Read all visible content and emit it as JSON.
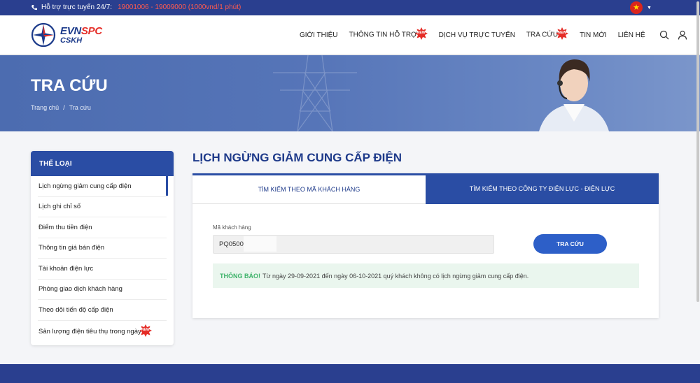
{
  "topbar": {
    "hotline_label": "Hỗ trợ trực tuyến 24/7:",
    "hotline_numbers": "19001006 - 19009000 (1000vnd/1 phút)",
    "language": "vi"
  },
  "header": {
    "logo_line1_a": "EVN",
    "logo_line1_b": "SPC",
    "logo_line2": "CSKH",
    "nav": [
      {
        "label": "GIỚI THIỆU",
        "badge": ""
      },
      {
        "label": "THÔNG TIN HỖ TRỢ",
        "badge": "NEW"
      },
      {
        "label": "DỊCH VỤ TRỰC TUYẾN",
        "badge": ""
      },
      {
        "label": "TRA CỨU",
        "badge": "NEW"
      },
      {
        "label": "TIN MỚI",
        "badge": ""
      },
      {
        "label": "LIÊN HỆ",
        "badge": ""
      }
    ],
    "icons": [
      "search-icon",
      "user-icon"
    ]
  },
  "hero": {
    "title": "TRA CỨU",
    "breadcrumb": [
      "Trang chủ",
      "Tra cứu"
    ]
  },
  "sidebar": {
    "title": "THỂ LOẠI",
    "items": [
      {
        "label": "Lịch ngừng giảm cung cấp điện",
        "active": true
      },
      {
        "label": "Lịch ghi chỉ số"
      },
      {
        "label": "Điểm thu tiền điện"
      },
      {
        "label": "Thông tin giá bán điện"
      },
      {
        "label": "Tài khoản điện lực"
      },
      {
        "label": "Phòng giao dịch khách hàng"
      },
      {
        "label": "Theo dõi tiến độ cấp điện"
      },
      {
        "label": "Sản lượng điện tiêu thụ trong ngày",
        "badge": "NEW"
      }
    ]
  },
  "main": {
    "title": "LỊCH NGỪNG GIẢM CUNG CẤP ĐIỆN",
    "tabs": [
      {
        "label": "TÌM KIẾM THEO MÃ KHÁCH HÀNG",
        "active": true
      },
      {
        "label": "TÌM KIẾM THEO CÔNG TY ĐIỆN LỰC - ĐIỆN LỰC",
        "active": false
      }
    ],
    "field_label": "Mã khách hàng",
    "field_value": "PQ0500",
    "search_button": "TRA CỨU",
    "notice_label": "THÔNG BÁO!",
    "notice_text": "Từ ngày 29-09-2021 đến ngày 06-10-2021 quý khách không có lịch ngừng giảm cung cấp điện."
  },
  "colors": {
    "primary": "#2a4da4",
    "topbar": "#2a3f8f",
    "hotline": "#ff5b4f",
    "notice_label": "#3fb36b",
    "badge": "#e52d27"
  }
}
